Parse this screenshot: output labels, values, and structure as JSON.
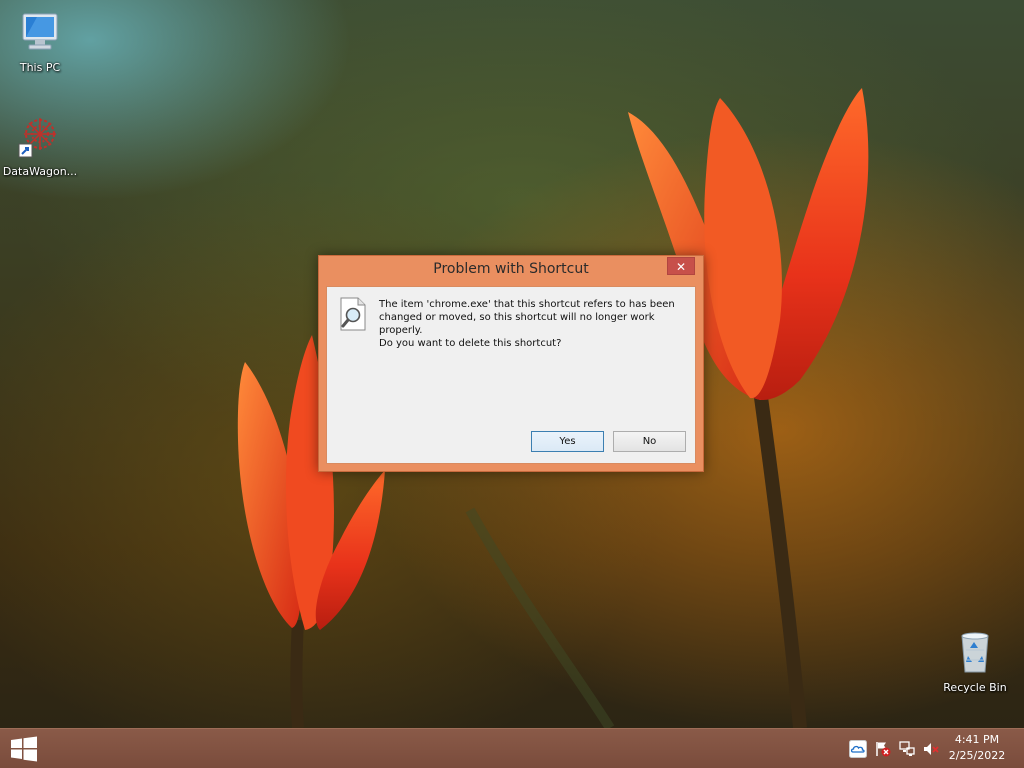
{
  "desktop": {
    "icons": [
      {
        "label": "This PC",
        "icon": "this-pc-icon"
      },
      {
        "label": "DataWagon...",
        "icon": "datawagon-shortcut-icon"
      },
      {
        "label": "Recycle Bin",
        "icon": "recycle-bin-icon"
      }
    ]
  },
  "dialog": {
    "title": "Problem with Shortcut",
    "close_label": "✕",
    "message": "The item 'chrome.exe' that this shortcut refers to has been changed or moved, so this shortcut will no longer work properly.",
    "question": "Do you want to delete this shortcut?",
    "yes_label": "Yes",
    "no_label": "No",
    "icon": "search-document-icon"
  },
  "taskbar": {
    "start_icon": "windows-logo-icon",
    "tray_icons": [
      "onedrive-cloud-icon",
      "action-center-flag-icon",
      "network-icon",
      "volume-muted-icon"
    ],
    "clock": {
      "time": "4:41 PM",
      "date": "2/25/2022"
    }
  },
  "colors": {
    "dialog_frame": "#ea8f60",
    "taskbar": "#7a4c3c",
    "close_button": "#c7504a",
    "default_button_border": "#3c7fb1"
  }
}
